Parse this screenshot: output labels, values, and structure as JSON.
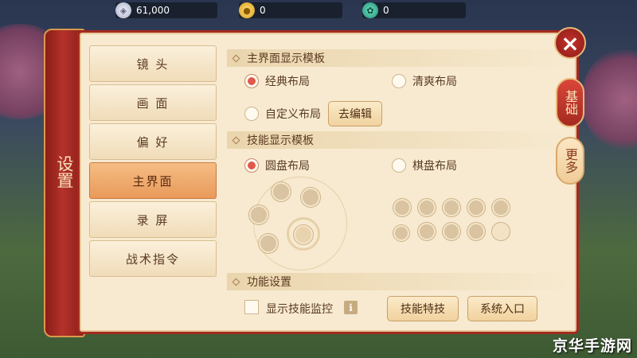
{
  "currencies": [
    {
      "icon": "silver-coin-icon",
      "value": "61,000",
      "color": "#c9cde0"
    },
    {
      "icon": "gold-coin-icon",
      "value": "0",
      "color": "#f1b82c"
    },
    {
      "icon": "jade-icon",
      "value": "0",
      "color": "#3bbf9a"
    }
  ],
  "side_tab": {
    "label": "设置"
  },
  "menu": [
    {
      "label": "镜 头",
      "active": false
    },
    {
      "label": "画 面",
      "active": false
    },
    {
      "label": "偏 好",
      "active": false
    },
    {
      "label": "主界面",
      "active": true
    },
    {
      "label": "录 屏",
      "active": false
    },
    {
      "label": "战术指令",
      "active": false
    }
  ],
  "sections": {
    "main_ui": {
      "title": "主界面显示模板",
      "options": [
        {
          "label": "经典布局",
          "checked": true
        },
        {
          "label": "清爽布局",
          "checked": false
        },
        {
          "label": "自定义布局",
          "checked": false
        }
      ],
      "edit_button": "去编辑"
    },
    "skill": {
      "title": "技能显示模板",
      "options": [
        {
          "label": "圆盘布局",
          "checked": true
        },
        {
          "label": "棋盘布局",
          "checked": false
        }
      ]
    },
    "function": {
      "title": "功能设置",
      "monitor_label": "显示技能监控",
      "monitor_checked": false,
      "info_icon": "i",
      "skill_special_button": "技能特技",
      "system_entry_button": "系统入口"
    }
  },
  "right_tabs": {
    "basic": "基础",
    "more": "更多"
  },
  "close_icon": "×",
  "watermark": "京华手游网",
  "colors": {
    "accent_red": "#a52a20",
    "panel_bg": "#f7ead0",
    "active_menu": "#e89a5a"
  }
}
